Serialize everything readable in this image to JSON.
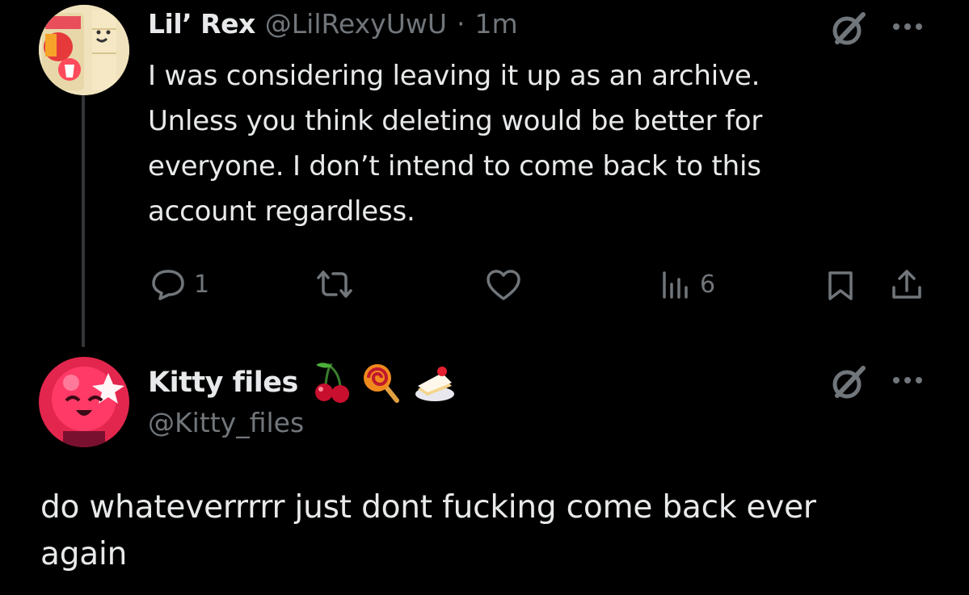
{
  "tweet1": {
    "display_name": "Lil’ Rex",
    "handle": "@LilRexyUwU",
    "separator": "·",
    "time": "1m",
    "text_lines": [
      "I was considering leaving it up as an archive.",
      "Unless you think deleting would be better for",
      "everyone. I don’t intend to come back to this",
      "account regardless."
    ],
    "actions": {
      "reply_count": "1",
      "retweet_count": "",
      "like_count": "",
      "views_count": "6"
    }
  },
  "tweet2": {
    "display_name": "Kitty files",
    "handle": "@Kitty_files",
    "emojis": [
      "cherries-emoji",
      "lollipop-emoji",
      "cake-emoji"
    ],
    "text_lines": [
      "do whateverrrrr just dont fucking come back ever",
      "again"
    ]
  },
  "colors": {
    "background": "#000000",
    "text": "#e7e9ea",
    "muted": "#71767b",
    "thread_line": "#333639"
  }
}
